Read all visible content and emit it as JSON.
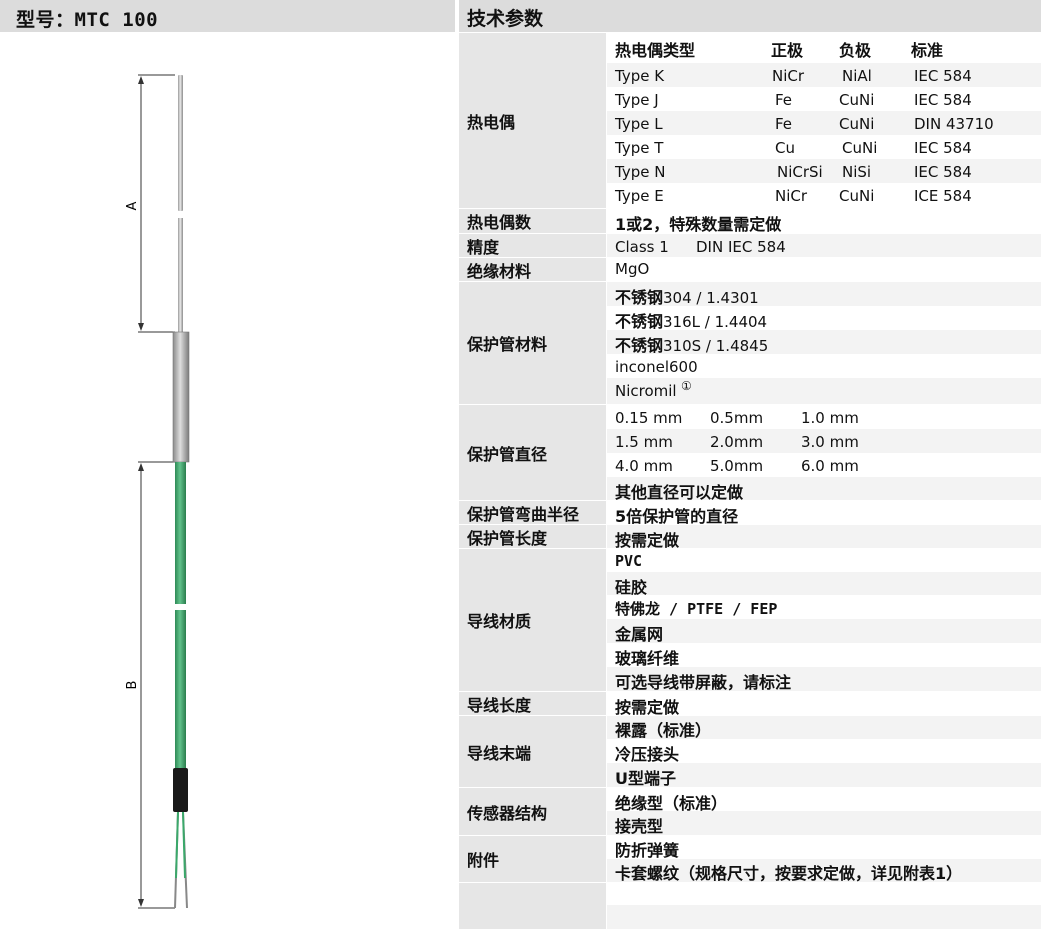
{
  "left_header": "型号：MTC 100",
  "right_header": "技术参数",
  "diagram": {
    "label_a": "A",
    "label_b": "B"
  },
  "thermocouple": {
    "label": "热电偶",
    "headers": [
      "热电偶类型",
      "正极",
      "负极",
      "标准"
    ],
    "rows": [
      [
        "Type K",
        "NiCr",
        "NiAl",
        "IEC 584"
      ],
      [
        "Type J",
        "Fe",
        "CuNi",
        "IEC 584"
      ],
      [
        "Type L",
        "Fe",
        "CuNi",
        "DIN 43710"
      ],
      [
        "Type T",
        "Cu",
        "CuNi",
        "IEC 584"
      ],
      [
        "Type N",
        "NiCrSi",
        "NiSi",
        "IEC 584"
      ],
      [
        "Type E",
        "NiCr",
        "CuNi",
        "ICE 584"
      ]
    ]
  },
  "count": {
    "label": "热电偶数",
    "value": "1或2，特殊数量需定做"
  },
  "accuracy": {
    "label": "精度",
    "class": "Class 1",
    "standard": "DIN IEC 584"
  },
  "insulation": {
    "label": "绝缘材料",
    "value": "MgO"
  },
  "sheath_material": {
    "label": "保护管材料",
    "items": [
      {
        "prefix": "不锈钢",
        "text": "304 / 1.4301"
      },
      {
        "prefix": "不锈钢",
        "text": "316L / 1.4404"
      },
      {
        "prefix": "不锈钢",
        "text": "310S / 1.4845"
      },
      {
        "prefix": "",
        "text": "inconel600"
      },
      {
        "prefix": "",
        "text": "Nicromil"
      }
    ],
    "footnote_mark": "①"
  },
  "sheath_diameter": {
    "label": "保护管直径",
    "rows": [
      [
        "0.15 mm",
        "0.5mm",
        "1.0 mm"
      ],
      [
        "1.5 mm",
        "2.0mm",
        "3.0 mm"
      ],
      [
        "4.0 mm",
        "5.0mm",
        "6.0 mm"
      ]
    ],
    "note": "其他直径可以定做"
  },
  "bend_radius": {
    "label": "保护管弯曲半径",
    "value": "5倍保护管的直径"
  },
  "sheath_length": {
    "label": "保护管长度",
    "value": "按需定做"
  },
  "lead_material": {
    "label": "导线材质",
    "items": [
      "PVC",
      "硅胶",
      "特佛龙 / PTFE / FEP",
      "金属网",
      "玻璃纤维",
      "可选导线带屏蔽，请标注"
    ]
  },
  "lead_length": {
    "label": "导线长度",
    "value": "按需定做"
  },
  "lead_end": {
    "label": "导线末端",
    "items": [
      "裸露（标准）",
      "冷压接头",
      "U型端子"
    ]
  },
  "sensor_structure": {
    "label": "传感器结构",
    "items": [
      "绝缘型（标准）",
      "接壳型"
    ]
  },
  "accessories": {
    "label": "附件",
    "items": [
      "防折弹簧",
      "卡套螺纹（规格尺寸，按要求定做，详见附表1）"
    ]
  },
  "colors": {
    "header_bg": "#dcdcdc",
    "label_bg": "#e6e6e6",
    "stripe": "#f3f3f3",
    "wire_green": "#3aa86a",
    "sheath_grey": "#b9b9b9"
  }
}
